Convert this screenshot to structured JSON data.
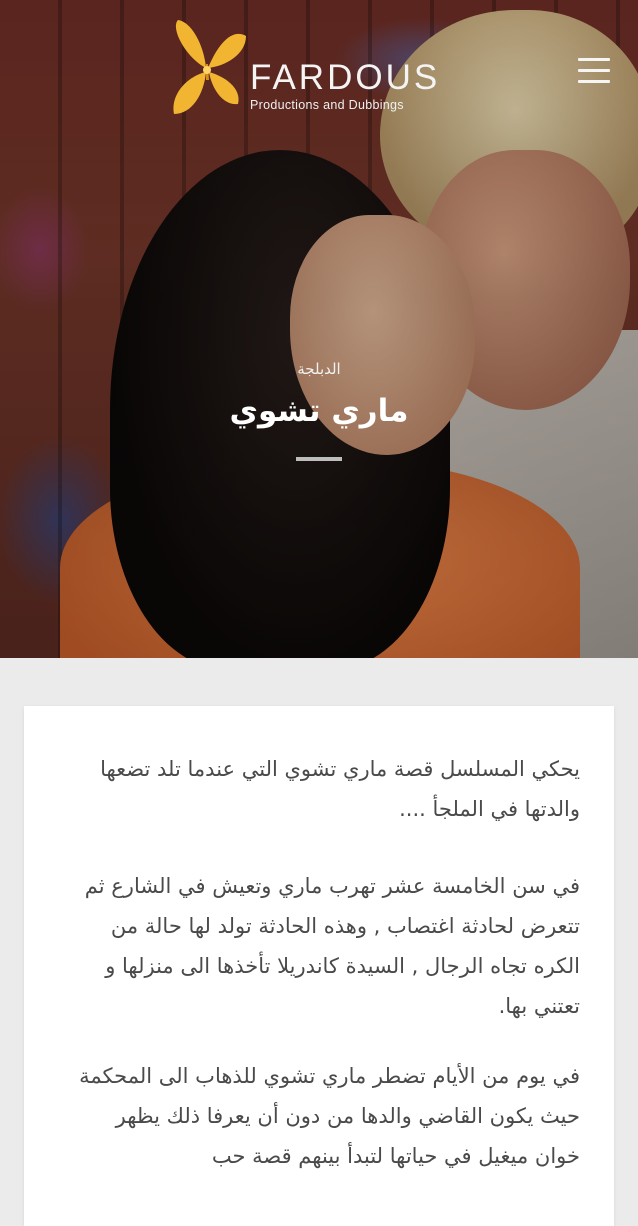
{
  "header": {
    "brand": "FARDOUS",
    "tagline": "Productions and Dubbings",
    "logo_icon": "butterfly-icon",
    "menu_icon": "hamburger-menu-icon"
  },
  "hero": {
    "category": "الدبلجة",
    "title": "ماري تشوي"
  },
  "article": {
    "paragraphs": [
      "يحكي المسلسل قصة ماري تشوي التي عندما تلد تضعها والدتها في الملجأ ....",
      "في سن الخامسة عشر تهرب ماري وتعيش في الشارع ثم تتعرض لحادثة اغتصاب , وهذه الحادثة تولد لها حالة من الكره تجاه الرجال , السيدة كاندريلا تأخذها الى منزلها و تعتني بها.",
      "في يوم من الأيام تضطر ماري تشوي للذهاب الى المحكمة حيث يكون القاضي والدها من دون أن يعرفا ذلك يظهر خوان ميغيل في حياتها لتبدأ بينهم قصة حب"
    ]
  },
  "colors": {
    "logo_gold": "#f2b531",
    "page_background": "#ebebeb",
    "card_background": "#ffffff",
    "body_text": "#4a4a4a"
  }
}
